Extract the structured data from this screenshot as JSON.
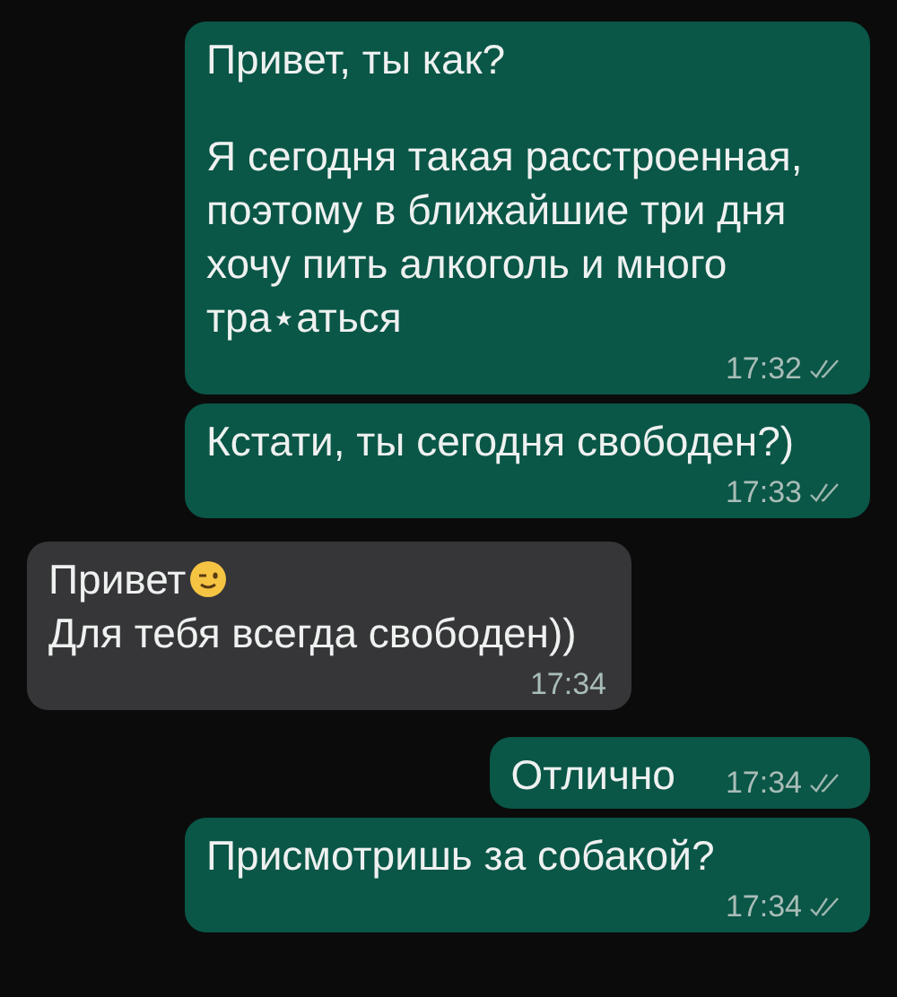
{
  "messages": [
    {
      "kind": "outgoing",
      "paragraphs": [
        {
          "lines": [
            "Привет, ты как?"
          ]
        },
        {
          "lines": [
            "Я сегодня такая расстроенная,",
            "поэтому в ближайшие три дня",
            "хочу пить алкоголь и много",
            "тра⋆аться"
          ]
        }
      ],
      "time": "17:32",
      "ticks": true
    },
    {
      "kind": "outgoing",
      "paragraphs": [
        {
          "lines": [
            "Кстати, ты сегодня свободен?)"
          ]
        }
      ],
      "time": "17:33",
      "ticks": true
    },
    {
      "kind": "incoming",
      "paragraphs": [
        {
          "lines": [
            "Привет"
          ],
          "emoji": true
        },
        {
          "lines": [
            "Для тебя всегда свободен))"
          ]
        }
      ],
      "time": "17:34",
      "ticks": false
    },
    {
      "kind": "outgoing",
      "paragraphs": [
        {
          "lines": [
            "Отлично"
          ]
        }
      ],
      "time": "17:34",
      "ticks": true
    },
    {
      "kind": "outgoing",
      "paragraphs": [
        {
          "lines": [
            "Присмотришь за собакой?"
          ]
        }
      ],
      "time": "17:34",
      "ticks": true
    }
  ]
}
